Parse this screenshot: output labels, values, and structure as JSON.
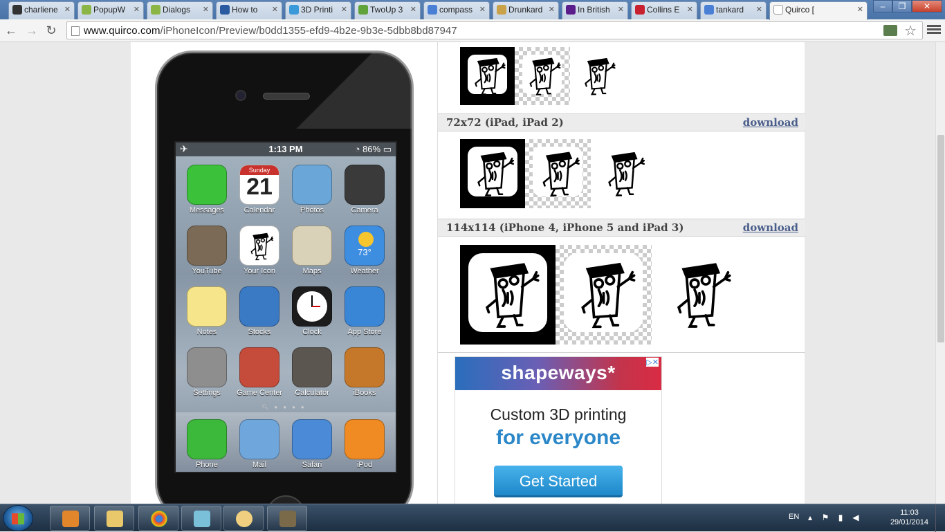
{
  "tabs": [
    {
      "label": "charliene",
      "icon": "github-icon",
      "color": "#333333"
    },
    {
      "label": "PopupW",
      "icon": "android-icon",
      "color": "#8bb645"
    },
    {
      "label": "Dialogs",
      "icon": "android-icon",
      "color": "#8bb645"
    },
    {
      "label": "How to",
      "icon": "stackexchange-icon",
      "color": "#2c5aa0"
    },
    {
      "label": "3D Printi",
      "icon": "shapeways-icon",
      "color": "#3a9ad9"
    },
    {
      "label": "TwoUp 3",
      "icon": "thingiverse-icon",
      "color": "#5fa33a"
    },
    {
      "label": "compass",
      "icon": "google-icon",
      "color": "#4a7fd6"
    },
    {
      "label": "Drunkard",
      "icon": "image-icon",
      "color": "#c9a24a"
    },
    {
      "label": "In British",
      "icon": "yahoo-icon",
      "color": "#5b1c8c"
    },
    {
      "label": "Collins E",
      "icon": "collins-icon",
      "color": "#c8202f"
    },
    {
      "label": "tankard",
      "icon": "google-icon",
      "color": "#4a7fd6"
    },
    {
      "label": "Quirco [",
      "icon": "page-icon",
      "color": "#ffffff"
    }
  ],
  "address": {
    "host": "www.quirco.com",
    "path": "/iPhoneIcon/Preview/b0dd1355-efd9-4b2e-9b3e-5dbb8bd87947"
  },
  "phone": {
    "status_time": "1:13 PM",
    "battery": "86%",
    "calendar_day": "Sunday",
    "calendar_date": "21",
    "weather_temp": "73°",
    "apps": [
      {
        "label": "Messages",
        "icon": "messages-icon",
        "color": "#3cc13b"
      },
      {
        "label": "Calendar",
        "icon": "calendar-icon",
        "color": "#ffffff"
      },
      {
        "label": "Photos",
        "icon": "sunflower-icon",
        "color": "#6aa6d8"
      },
      {
        "label": "Camera",
        "icon": "camera-icon",
        "color": "#3a3a3a"
      },
      {
        "label": "YouTube",
        "icon": "youtube-icon",
        "color": "#7b6a55"
      },
      {
        "label": "Your Icon",
        "icon": "custom-app-icon",
        "color": "#ffffff"
      },
      {
        "label": "Maps",
        "icon": "maps-icon",
        "color": "#d9d2b8"
      },
      {
        "label": "Weather",
        "icon": "weather-icon",
        "color": "#3d8de0"
      },
      {
        "label": "Notes",
        "icon": "notes-icon",
        "color": "#f6e58a"
      },
      {
        "label": "Stocks",
        "icon": "stocks-icon",
        "color": "#3a79c4"
      },
      {
        "label": "Clock",
        "icon": "clock-icon",
        "color": "#1c1c1c"
      },
      {
        "label": "App Store",
        "icon": "appstore-icon",
        "color": "#3a86d6"
      },
      {
        "label": "Settings",
        "icon": "settings-icon",
        "color": "#8e8e8e"
      },
      {
        "label": "Game Center",
        "icon": "gamecenter-icon",
        "color": "#c54b3a"
      },
      {
        "label": "Calculator",
        "icon": "calculator-icon",
        "color": "#5c5650"
      },
      {
        "label": "iBooks",
        "icon": "ibooks-icon",
        "color": "#c6782a"
      }
    ],
    "dock": [
      {
        "label": "Phone",
        "icon": "phone-icon",
        "color": "#3cb83a"
      },
      {
        "label": "Mail",
        "icon": "mail-icon",
        "color": "#6fa6dc"
      },
      {
        "label": "Safari",
        "icon": "safari-icon",
        "color": "#4a8ad6"
      },
      {
        "label": "iPod",
        "icon": "ipod-icon",
        "color": "#f08a22"
      }
    ]
  },
  "sections": [
    {
      "title": "72x72 (iPad, iPad 2)",
      "download": "download"
    },
    {
      "title": "114x114 (iPhone 4, iPhone 5 and iPad 3)",
      "download": "download"
    }
  ],
  "ad": {
    "brand": "shapeways*",
    "line1": "Custom 3D printing",
    "line2": "for everyone",
    "button": "Get Started",
    "info": "▷✕"
  },
  "taskbar": {
    "lang": "EN",
    "time": "11:03",
    "date": "29/01/2014"
  }
}
